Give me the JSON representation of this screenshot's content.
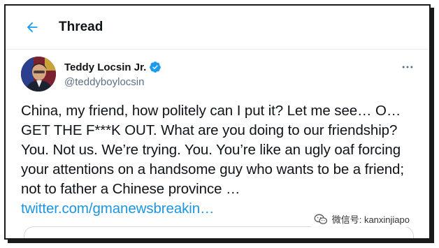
{
  "header": {
    "title": "Thread",
    "back_icon": "arrow-left-icon"
  },
  "author": {
    "display_name": "Teddy Locsin Jr.",
    "handle": "@teddyboylocsin",
    "verified": true,
    "verified_icon": "verified-badge-icon"
  },
  "tweet": {
    "text": "China, my friend, how politely can I put it? Let me see… O…GET THE F***K OUT. What are you doing to our friendship? You. Not us. We’re trying. You. You’re like an ugly oaf forcing your attentions on a handsome guy who wants to be a friend; not to father a Chinese province … ",
    "link_text": "twitter.com/gmanewsbreakin…"
  },
  "watermark": {
    "text": "微信号: kanxinjiapo",
    "icon": "wechat-icon"
  },
  "colors": {
    "accent": "#1b95e0",
    "verified": "#1d9bf0",
    "text": "#0f1419",
    "secondary": "#5b7083"
  }
}
